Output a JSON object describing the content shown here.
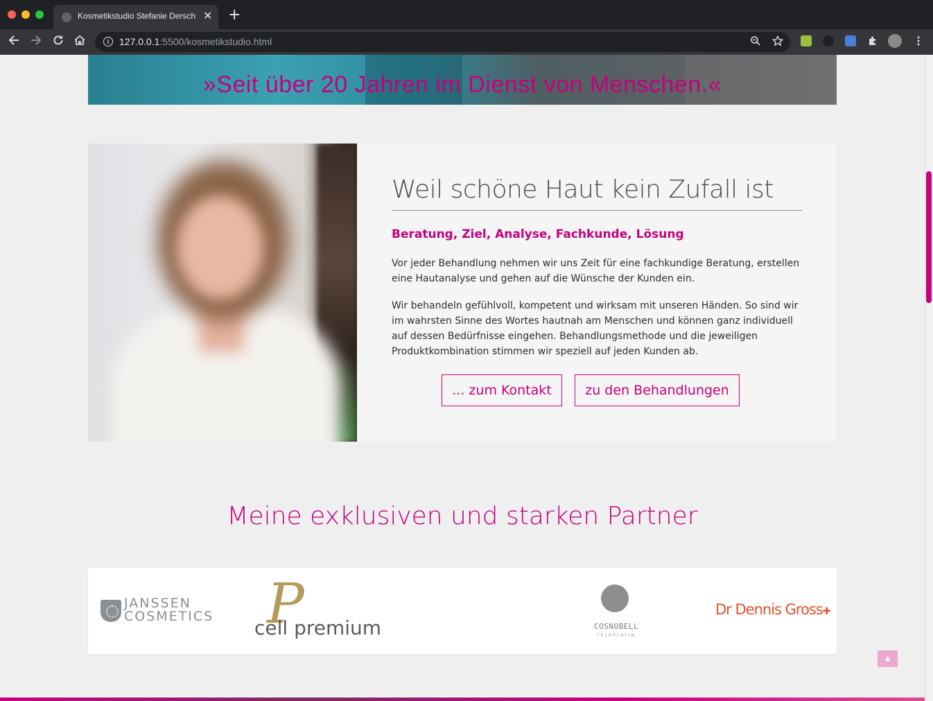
{
  "browser": {
    "tab_title": "Kosmetikstudio Stefanie Dersch",
    "tab_close": "✕",
    "new_tab": "+",
    "url_host": "127.0.0.1",
    "url_path": ":5500/kosmetikstudio.html",
    "icons": [
      "back-icon",
      "forward-icon",
      "reload-icon",
      "home-icon",
      "info-icon",
      "zoom-icon",
      "star-icon",
      "extension-icons",
      "menu-icon"
    ]
  },
  "hero": {
    "quote": "»Seit über 20 Jahren im Dienst von Menschen.«"
  },
  "about": {
    "title": "Weil schöne Haut kein Zufall ist",
    "subtitle": "Beratung, Ziel, Analyse, Fachkunde, Lösung",
    "paragraph1": "Vor jeder Behandlung nehmen wir uns Zeit für eine fachkundige Beratung, erstellen eine Hautanalyse und gehen auf die Wünsche der Kunden ein.",
    "paragraph2": "Wir behandeln gefühlvoll, kompetent und wirksam mit unseren Händen. So sind wir im wahrsten Sinne des Wortes hautnah am Menschen und können ganz individuell auf dessen Bedürfnisse eingehen. Behandlungsmethode und die jeweiligen Produktkombination stimmen wir speziell auf jeden Kunden ab.",
    "button_contact": "... zum Kontakt",
    "button_treatments": "zu den Behandlungen"
  },
  "partners": {
    "title": "Meine exklusiven und starken Partner",
    "logos": [
      {
        "name": "janssen-cosmetics",
        "line1": "JANSSEN",
        "line2": "COSMETICS"
      },
      {
        "name": "cell-premium",
        "mark": "P",
        "text": "cell premium"
      },
      {
        "name": "cosnobell",
        "text": "COSNOBELL",
        "sub": "TELOPLATIN"
      },
      {
        "name": "dr-dennis-gross",
        "text": "Dr Dennis Gross",
        "mark": "✚"
      }
    ]
  },
  "to_top": "▲",
  "colors": {
    "accent": "#c6007e",
    "chrome": "#202124",
    "toolbar": "#35363a"
  }
}
